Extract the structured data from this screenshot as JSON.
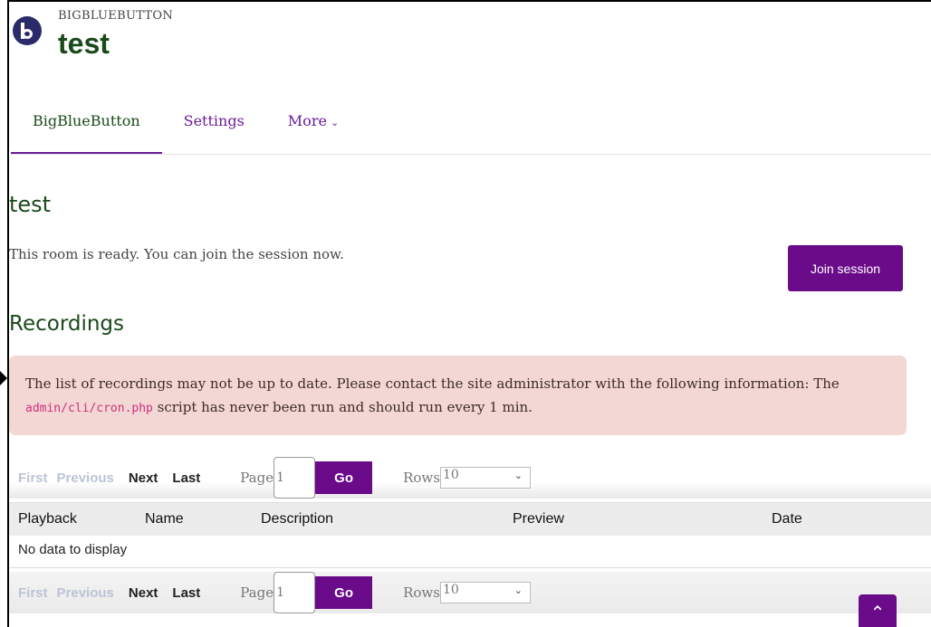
{
  "header": {
    "site_name": "BIGBLUEBUTTON",
    "course_title": "test"
  },
  "tabs": [
    {
      "label": "BigBlueButton",
      "active": true
    },
    {
      "label": "Settings",
      "active": false
    },
    {
      "label": "More",
      "active": false
    }
  ],
  "room": {
    "title": "test",
    "status_text": "This room is ready. You can join the session now.",
    "join_label": "Join session"
  },
  "recordings": {
    "heading": "Recordings",
    "alert_pre": "The list of recordings may not be up to date. Please contact the site administrator with the following information: The ",
    "alert_code": "admin/cli/cron.php",
    "alert_post": " script has never been run and should run every 1 min."
  },
  "pager": {
    "first": "First",
    "previous": "Previous",
    "next": "Next",
    "last": "Last",
    "page_label": "Page",
    "page_value": "1",
    "go_label": "Go",
    "rows_label": "Rows",
    "rows_value": "10"
  },
  "table": {
    "columns": [
      "Playback",
      "Name",
      "Description",
      "Preview",
      "Date"
    ],
    "empty_text": "No data to display"
  },
  "colors": {
    "accent": "#6a0b8a",
    "heading": "#1a4a1a",
    "alert_bg": "#f3d7d4"
  }
}
